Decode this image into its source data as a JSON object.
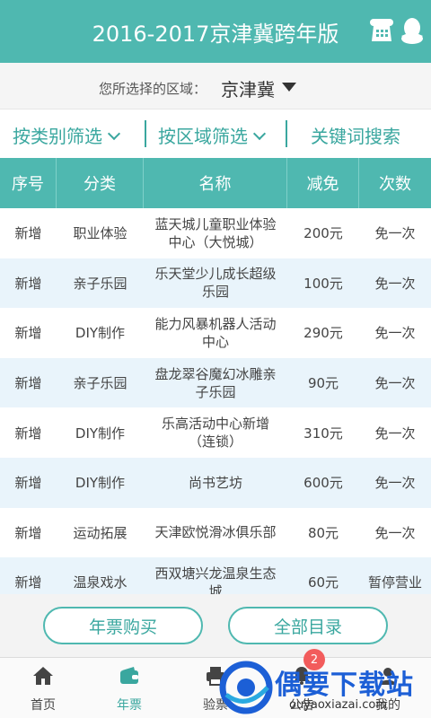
{
  "header": {
    "title": "2016-2017京津冀跨年版"
  },
  "region": {
    "label": "您所选择的区域：",
    "value": "京津冀"
  },
  "filters": {
    "by_category": "按类别筛选",
    "by_region": "按区域筛选",
    "keyword_search": "关键词搜索"
  },
  "table": {
    "columns": [
      "序号",
      "分类",
      "名称",
      "减免",
      "次数"
    ],
    "rows": [
      [
        "新增",
        "职业体验",
        "蓝天城儿童职业体验中心（大悦城）",
        "200元",
        "免一次"
      ],
      [
        "新增",
        "亲子乐园",
        "乐天堂少儿成长超级乐园",
        "100元",
        "免一次"
      ],
      [
        "新增",
        "DIY制作",
        "能力风暴机器人活动中心",
        "290元",
        "免一次"
      ],
      [
        "新增",
        "亲子乐园",
        "盘龙翠谷魔幻冰雕亲子乐园",
        "90元",
        "免一次"
      ],
      [
        "新增",
        "DIY制作",
        "乐高活动中心新增（连锁）",
        "310元",
        "免一次"
      ],
      [
        "新增",
        "DIY制作",
        "尚书艺坊",
        "600元",
        "免一次"
      ],
      [
        "新增",
        "运动拓展",
        "天津欧悦滑冰俱乐部",
        "80元",
        "免一次"
      ],
      [
        "新增",
        "温泉戏水",
        "西双塘兴龙温泉生态城",
        "60元",
        "暂停营业"
      ]
    ]
  },
  "buttons": {
    "buy_ticket": "年票购买",
    "all_catalog": "全部目录"
  },
  "tabs": [
    {
      "label": "首页",
      "icon": "home-icon"
    },
    {
      "label": "年票",
      "icon": "wallet-icon"
    },
    {
      "label": "验票",
      "icon": "printer-icon"
    },
    {
      "label": "公告",
      "icon": "bell-icon"
    },
    {
      "label": "我的",
      "icon": "user-icon"
    }
  ],
  "notice_badge": "2",
  "watermark": {
    "main": "偶要下载站",
    "sub": "ouyaoxiazai.com"
  },
  "colors": {
    "accent": "#4fb8b0",
    "accent_text": "#3aa79f",
    "alt_row": "#e9f4fb",
    "badge": "#f25c5c"
  }
}
